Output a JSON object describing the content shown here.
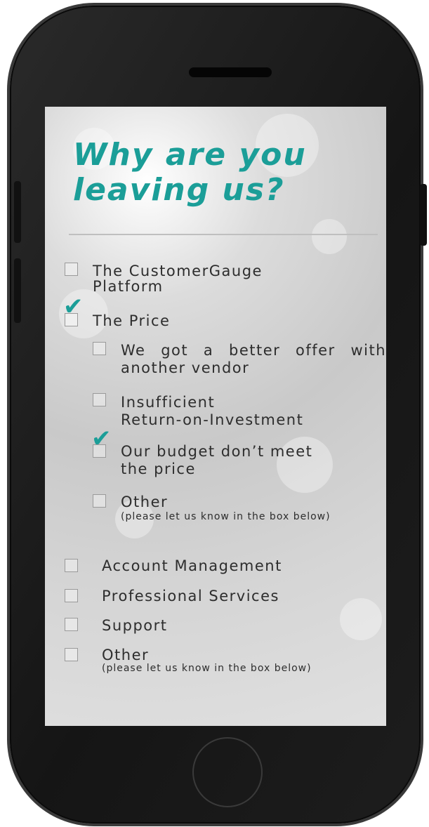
{
  "survey": {
    "title_line1": "Why are you",
    "title_line2": "leaving us?",
    "accent_color": "#1b9e98",
    "options": [
      {
        "label_line1": "The CustomerGauge",
        "label_line2": "Platform",
        "checked": false
      },
      {
        "label": "The Price",
        "checked": true,
        "sub_options": [
          {
            "label": "We got a better offer with another vendor",
            "checked": false
          },
          {
            "label_line1": "Insufficient",
            "label_line2": "Return-on-Investment",
            "checked": false
          },
          {
            "label_line1": "Our budget don’t meet",
            "label_line2": "the price",
            "checked": true
          },
          {
            "label": "Other",
            "note": "(please let us know in the box below)",
            "checked": false
          }
        ]
      },
      {
        "label": "Account Management",
        "checked": false
      },
      {
        "label": "Professional Services",
        "checked": false
      },
      {
        "label": "Support",
        "checked": false
      },
      {
        "label": "Other",
        "note": "(please let us know in the box below)",
        "checked": false
      }
    ]
  },
  "icons": {
    "check": "checkmark-icon",
    "checkbox": "checkbox-icon"
  }
}
